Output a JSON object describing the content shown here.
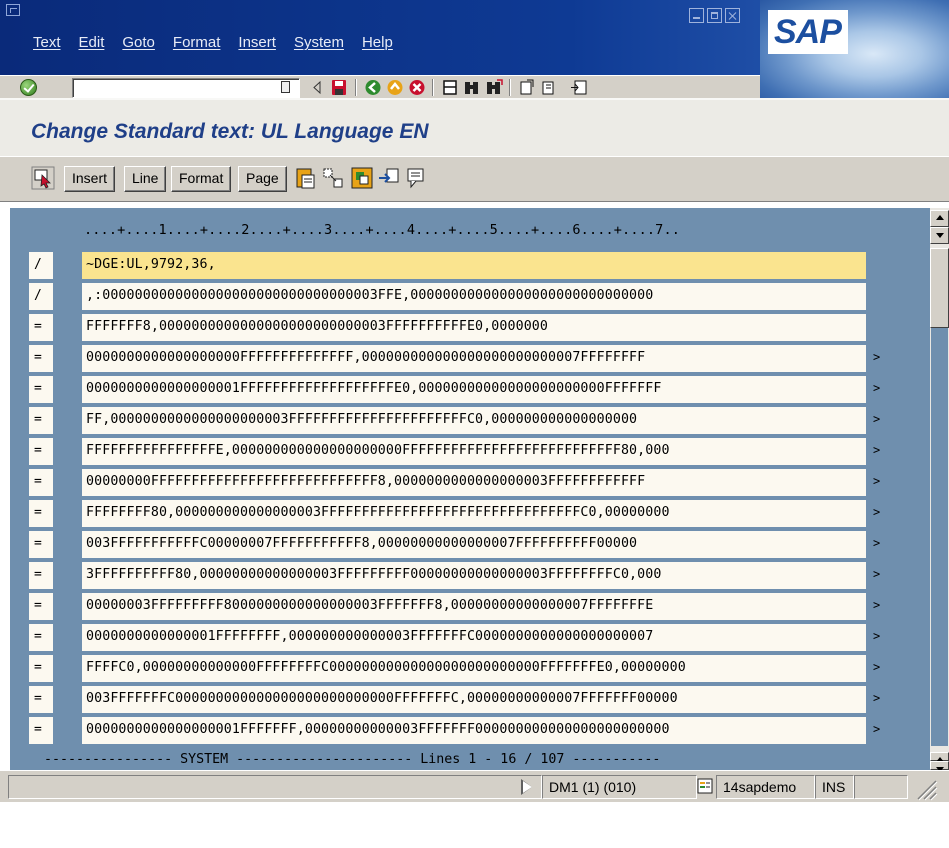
{
  "window": {
    "menu": [
      "Text",
      "Edit",
      "Goto",
      "Format",
      "Insert",
      "System",
      "Help"
    ],
    "logo_text": "SAP"
  },
  "toolbar": {
    "command_field_value": "",
    "icons": [
      "enter-icon",
      "command-dropdown-icon",
      "back-triangle-icon",
      "save-icon",
      "back-icon",
      "exit-icon",
      "cancel-icon",
      "print-icon",
      "find-icon",
      "find-next-icon",
      "first-page-icon",
      "previous-page-icon",
      "create-session-icon"
    ]
  },
  "title": "Change Standard text: UL Language EN",
  "app_toolbar": {
    "buttons": [
      "Insert",
      "Line",
      "Format",
      "Page"
    ],
    "icons": [
      "select-icon",
      "clipboard-paste-icon",
      "cut-icon",
      "copy-icon",
      "move-icon",
      "note-icon"
    ]
  },
  "editor": {
    "ruler": "....+....1....+....2....+....3....+....4....+....5....+....6....+....7..",
    "rows": [
      {
        "cmd": "/",
        "text": "~DGE:UL,9792,36,",
        "more": false,
        "active": true
      },
      {
        "cmd": "/",
        "text": ",:0000000000000000000000000000000003FFE,000000000000000000000000000000",
        "more": false,
        "active": false
      },
      {
        "cmd": "=",
        "text": "FFFFFFF8,0000000000000000000000000003FFFFFFFFFFE0,0000000",
        "more": false,
        "active": false
      },
      {
        "cmd": "=",
        "text": "0000000000000000000FFFFFFFFFFFFFF,000000000000000000000000007FFFFFFFF",
        "more": true,
        "active": false
      },
      {
        "cmd": "=",
        "text": "0000000000000000001FFFFFFFFFFFFFFFFFFFE0,00000000000000000000000FFFFFFF",
        "more": true,
        "active": false
      },
      {
        "cmd": "=",
        "text": "FF,0000000000000000000003FFFFFFFFFFFFFFFFFFFFFFC0,000000000000000000",
        "more": true,
        "active": false
      },
      {
        "cmd": "=",
        "text": "FFFFFFFFFFFFFFFFE,000000000000000000000FFFFFFFFFFFFFFFFFFFFFFFFFFF80,000",
        "more": true,
        "active": false
      },
      {
        "cmd": "=",
        "text": "00000000FFFFFFFFFFFFFFFFFFFFFFFFFFFF8,0000000000000000003FFFFFFFFFFFF",
        "more": true,
        "active": false
      },
      {
        "cmd": "=",
        "text": "FFFFFFFF80,000000000000000003FFFFFFFFFFFFFFFFFFFFFFFFFFFFFFFFC0,00000000",
        "more": true,
        "active": false
      },
      {
        "cmd": "=",
        "text": "003FFFFFFFFFFFC00000007FFFFFFFFFFF8,00000000000000007FFFFFFFFFF00000",
        "more": true,
        "active": false
      },
      {
        "cmd": "=",
        "text": "3FFFFFFFFFF80,00000000000000003FFFFFFFFF00000000000000003FFFFFFFFC0,000",
        "more": true,
        "active": false
      },
      {
        "cmd": "=",
        "text": "00000003FFFFFFFFF8000000000000000003FFFFFFF8,00000000000000007FFFFFFFE",
        "more": true,
        "active": false
      },
      {
        "cmd": "=",
        "text": "0000000000000001FFFFFFFF,000000000000003FFFFFFFC0000000000000000000007",
        "more": true,
        "active": false
      },
      {
        "cmd": "=",
        "text": "FFFFC0,00000000000000FFFFFFFFC00000000000000000000000000FFFFFFFE0,00000000",
        "more": true,
        "active": false
      },
      {
        "cmd": "=",
        "text": "003FFFFFFFC000000000000000000000000000FFFFFFFC,00000000000007FFFFFFF00000",
        "more": true,
        "active": false
      },
      {
        "cmd": "=",
        "text": "0000000000000000001FFFFFFF,00000000000003FFFFFFF000000000000000000000000",
        "more": true,
        "active": false
      }
    ],
    "more_marker": ">",
    "status_line": "---------------- SYSTEM ---------------------- Lines 1 - 16 / 107 -----------"
  },
  "status_bar": {
    "message": "",
    "system": "DM1 (1) (010)",
    "host": "14sapdemo",
    "mode": "INS"
  },
  "colors": {
    "title_bar": "#0e3a94",
    "title_text": "#1f3f88",
    "editor_background": "#6f8fae",
    "line_background": "#fcf9f0",
    "active_line": "#fae48f"
  }
}
